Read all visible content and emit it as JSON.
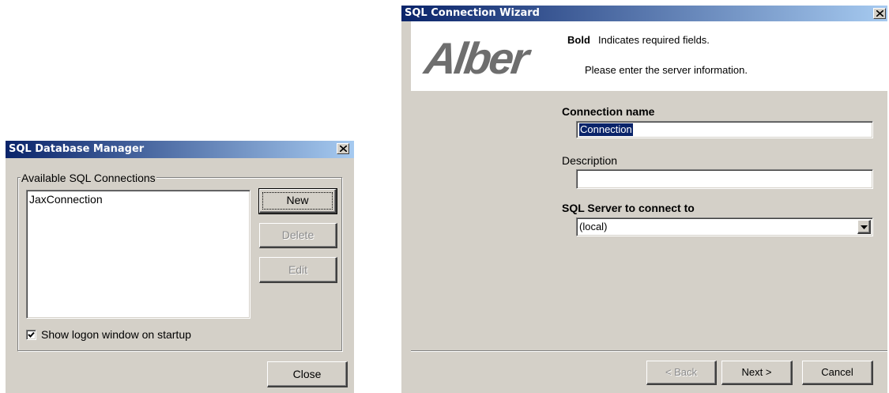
{
  "manager": {
    "title": "SQL Database Manager",
    "group_label": "Available SQL Connections",
    "connections": [
      "JaxConnection"
    ],
    "buttons": {
      "new": "New",
      "delete": "Delete",
      "edit": "Edit",
      "close": "Close"
    },
    "checkbox_label": "Show logon window on startup",
    "checkbox_checked": true
  },
  "wizard": {
    "title": "SQL Connection Wizard",
    "logo_text": "Alber",
    "bold_word": "Bold",
    "required_note": "Indicates required fields.",
    "instruction": "Please enter the server information.",
    "connection_name_label": "Connection name",
    "connection_name_value": "Connection",
    "description_label": "Description",
    "description_value": "",
    "server_label": "SQL Server to connect to",
    "server_value": "(local)",
    "buttons": {
      "back": "< Back",
      "next": "Next >",
      "cancel": "Cancel"
    }
  },
  "colors": {
    "face": "#d4d0c8",
    "title_start": "#0a246a",
    "title_end": "#a6caf0",
    "selection": "#0a246a",
    "logo": "#6e6e6e"
  }
}
